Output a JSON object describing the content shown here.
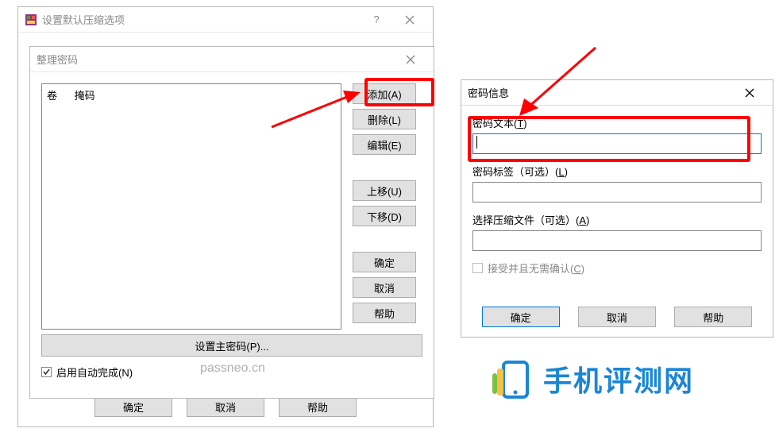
{
  "parent": {
    "title": "设置默认压缩选项",
    "icon": "winrar-icon",
    "buttons": {
      "ok": "确定",
      "cancel": "取消",
      "help": "帮助"
    }
  },
  "manage": {
    "title": "整理密码",
    "cols": {
      "vol": "卷",
      "mask": "掩码"
    },
    "side": {
      "add": "添加(A)",
      "del": "删除(L)",
      "edit": "编辑(E)",
      "up": "上移(U)",
      "down": "下移(D)",
      "ok": "确定",
      "cancel": "取消",
      "help": "帮助"
    },
    "master": "设置主密码(P)...",
    "auto": "启用自动完成(N)"
  },
  "info": {
    "title": "密码信息",
    "pwd_lbl_a": "密码文本(",
    "pwd_lbl_k": "T",
    "pwd_lbl_b": ")",
    "tag_lbl_a": "密码标签（可选）(",
    "tag_lbl_k": "L",
    "tag_lbl_b": ")",
    "arc_lbl_a": "选择压缩文件（可选）(",
    "arc_lbl_k": "A",
    "arc_lbl_b": ")",
    "chk_a": "接受并且无需确认(",
    "chk_k": "C",
    "chk_b": ")",
    "buttons": {
      "ok": "确定",
      "cancel": "取消",
      "help": "帮助"
    }
  },
  "brand": "手机评测网",
  "watermark": "passneo.cn"
}
